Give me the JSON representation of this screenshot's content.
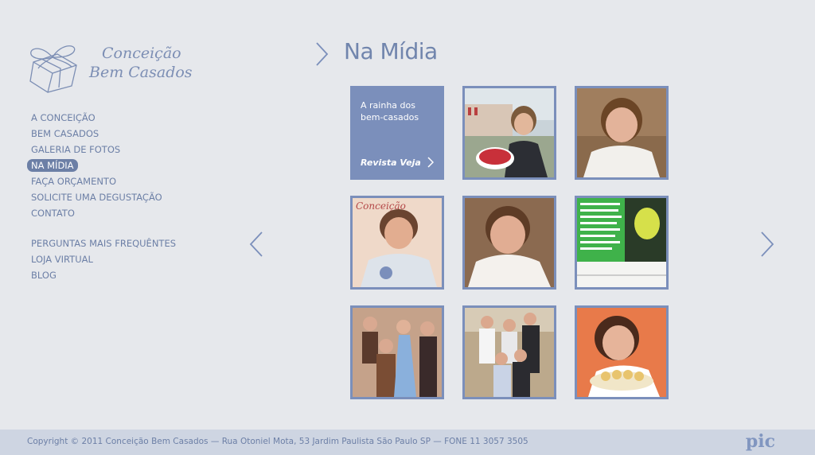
{
  "brand": {
    "line1": "Conceição",
    "line2": "Bem Casados"
  },
  "nav": {
    "items": [
      {
        "label": "A CONCEIÇÃO"
      },
      {
        "label": "BEM CASADOS"
      },
      {
        "label": "GALERIA DE FOTOS"
      },
      {
        "label": "NA MÍDIA",
        "active": true
      },
      {
        "label": "FAÇA ORÇAMENTO"
      },
      {
        "label": "SOLICITE UMA DEGUSTAÇÃO"
      },
      {
        "label": "CONTATO"
      }
    ],
    "secondary": [
      {
        "label": "PERGUNTAS MAIS FREQUÊNTES"
      },
      {
        "label": "LOJA VIRTUAL"
      },
      {
        "label": "BLOG"
      }
    ]
  },
  "page": {
    "title": "Na Mídia"
  },
  "gallery": {
    "feature": {
      "text": "A rainha dos bem-casados",
      "source": "Revista Veja"
    },
    "thumbnails": [
      {
        "name": "photo-woman-with-cake-box"
      },
      {
        "name": "photo-woman-portrait-1"
      },
      {
        "name": "photo-magazine-cover-woman"
      },
      {
        "name": "photo-woman-portrait-2"
      },
      {
        "name": "photo-magazine-article"
      },
      {
        "name": "photo-group-of-women"
      },
      {
        "name": "photo-family-group"
      },
      {
        "name": "photo-woman-with-sweets"
      }
    ]
  },
  "footer": {
    "text": "Copyright © 2011 Conceição Bem Casados  — Rua Otoniel Mota, 53 Jardim Paulista São Paulo SP — FONE 11 3057 3505",
    "credit": "pic"
  },
  "colors": {
    "accent": "#7b8fbb",
    "text": "#6c7fa6",
    "background": "#e6e8ec",
    "footer": "#ced5e2"
  }
}
